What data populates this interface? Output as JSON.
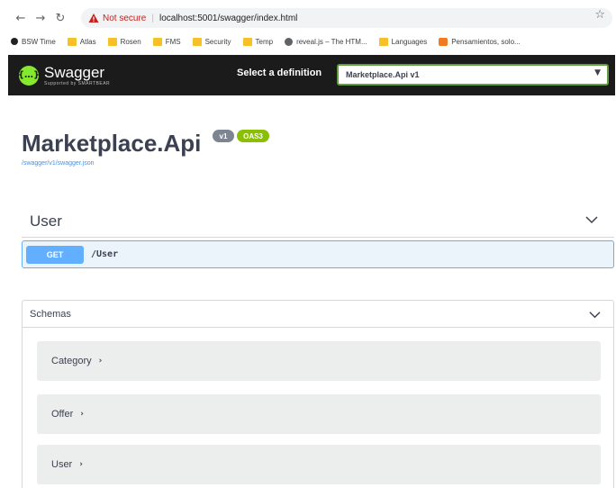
{
  "browser": {
    "back_icon": "arrow-left-icon",
    "forward_icon": "arrow-right-icon",
    "reload_icon": "reload-icon",
    "security_label": "Not secure",
    "url": "localhost:5001/swagger/index.html",
    "bookmark_icon": "star-icon",
    "bookmarks": [
      {
        "label": "BSW Time"
      },
      {
        "label": "Atlas"
      },
      {
        "label": "Rosen"
      },
      {
        "label": "FMS"
      },
      {
        "label": "Security"
      },
      {
        "label": "Temp"
      },
      {
        "label": "reveal.js – The HTM..."
      },
      {
        "label": "Languages"
      },
      {
        "label": "Pensamientos, solo..."
      }
    ]
  },
  "topbar": {
    "logo_title": "Swagger",
    "logo_sub": "Supported by SMARTBEAR",
    "select_label": "Select a definition",
    "selected_definition": "Marketplace.Api v1"
  },
  "info": {
    "title": "Marketplace.Api",
    "version": "v1",
    "oas": "OAS3",
    "spec_url": "/swagger/v1/swagger.json"
  },
  "tag": {
    "name": "User",
    "operations": [
      {
        "method": "GET",
        "path": "/User"
      }
    ]
  },
  "schemas": {
    "title": "Schemas",
    "models": [
      {
        "name": "Category"
      },
      {
        "name": "Offer"
      },
      {
        "name": "User"
      }
    ]
  },
  "colors": {
    "topbar_bg": "#1b1b1b",
    "logo_green": "#85ea2d",
    "get_blue": "#61affe",
    "get_bg": "#ebf3fb",
    "oas_green": "#89bf04",
    "version_gray": "#7d8492"
  }
}
